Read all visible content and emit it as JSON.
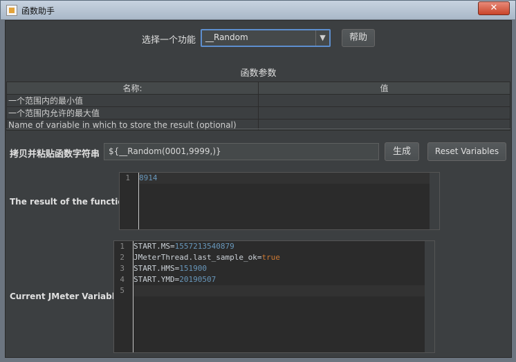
{
  "window": {
    "title": "函数助手",
    "close_label": "✕"
  },
  "selector": {
    "label": "选择一个功能",
    "selected": "__Random",
    "arrow": "▼",
    "help_label": "帮助"
  },
  "params": {
    "title": "函数参数",
    "headers": [
      "名称:",
      "值"
    ],
    "rows": [
      {
        "name": "一个范围内的最小值",
        "value": ""
      },
      {
        "name": "一个范围内允许的最大值",
        "value": ""
      },
      {
        "name": "Name of variable in which to store the result (optional)",
        "value": ""
      }
    ]
  },
  "copy": {
    "label": "拷贝并粘贴函数字符串",
    "value": "${__Random(0001,9999,)}",
    "generate_label": "生成",
    "reset_label": "Reset Variables"
  },
  "result": {
    "label": "The result of the function is",
    "line_numbers": [
      "1"
    ],
    "lines": [
      "8914"
    ]
  },
  "variables": {
    "label": "Current JMeter Variables",
    "line_numbers": [
      "1",
      "2",
      "3",
      "4",
      "5"
    ],
    "lines": [
      {
        "key": "START.MS",
        "eq": "=",
        "val": "1557213540879"
      },
      {
        "key": "JMeterThread.last_sample_ok",
        "eq": "=",
        "val": "true"
      },
      {
        "key": "START.HMS",
        "eq": "=",
        "val": "151900"
      },
      {
        "key": "START.YMD",
        "eq": "=",
        "val": "20190507"
      },
      {
        "key": "",
        "eq": "",
        "val": ""
      }
    ]
  },
  "colors": {
    "number": "#6897bb",
    "keyword": "#cc7832",
    "focus_border": "#5e8fcf"
  }
}
